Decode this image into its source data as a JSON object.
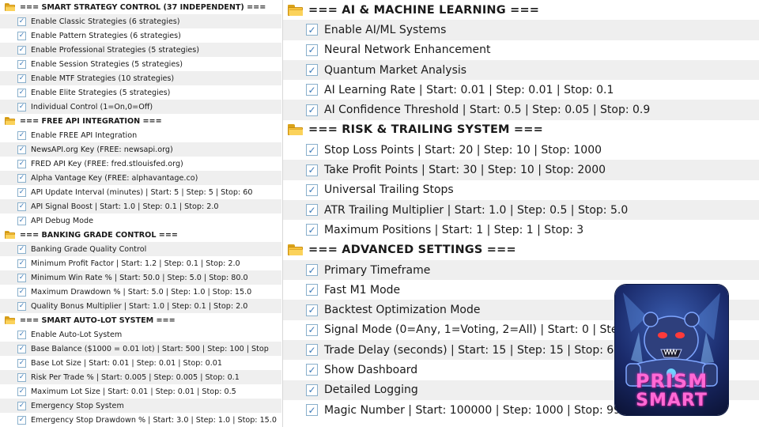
{
  "left_panel": {
    "rows": [
      {
        "type": "header",
        "label": "=== SMART STRATEGY CONTROL (37 INDEPENDENT) ==="
      },
      {
        "type": "item",
        "label": "Enable Classic Strategies (6 strategies)"
      },
      {
        "type": "item",
        "label": "Enable Pattern Strategies (6 strategies)"
      },
      {
        "type": "item",
        "label": "Enable Professional Strategies (5 strategies)"
      },
      {
        "type": "item",
        "label": "Enable Session Strategies (5 strategies)"
      },
      {
        "type": "item",
        "label": "Enable MTF Strategies (10 strategies)"
      },
      {
        "type": "item",
        "label": "Enable Elite Strategies (5 strategies)"
      },
      {
        "type": "item",
        "label": "Individual Control (1=On,0=Off)"
      },
      {
        "type": "header",
        "label": "=== FREE API INTEGRATION ==="
      },
      {
        "type": "item",
        "label": "Enable FREE API Integration"
      },
      {
        "type": "item",
        "label": "NewsAPI.org Key (FREE: newsapi.org)"
      },
      {
        "type": "item",
        "label": "FRED API Key (FREE: fred.stlouisfed.org)"
      },
      {
        "type": "item",
        "label": "Alpha Vantage Key (FREE: alphavantage.co)"
      },
      {
        "type": "item",
        "label": "API Update Interval (minutes) | Start: 5 | Step: 5 | Stop: 60"
      },
      {
        "type": "item",
        "label": "API Signal Boost | Start: 1.0 | Step: 0.1 | Stop: 2.0"
      },
      {
        "type": "item",
        "label": "API Debug Mode"
      },
      {
        "type": "header",
        "label": "=== BANKING GRADE CONTROL ==="
      },
      {
        "type": "item",
        "label": "Banking Grade Quality Control"
      },
      {
        "type": "item",
        "label": "Minimum Profit Factor | Start: 1.2 | Step: 0.1 | Stop: 2.0"
      },
      {
        "type": "item",
        "label": "Minimum Win Rate % | Start: 50.0 | Step: 5.0 | Stop: 80.0"
      },
      {
        "type": "item",
        "label": "Maximum Drawdown % | Start: 5.0 | Step: 1.0 | Stop: 15.0"
      },
      {
        "type": "item",
        "label": "Quality Bonus Multiplier | Start: 1.0 | Step: 0.1 | Stop: 2.0"
      },
      {
        "type": "header",
        "label": "=== SMART AUTO-LOT SYSTEM ==="
      },
      {
        "type": "item",
        "label": "Enable Auto-Lot System"
      },
      {
        "type": "item",
        "label": "Base Balance ($1000 = 0.01 lot) | Start: 500 | Step: 100 | Stop"
      },
      {
        "type": "item",
        "label": "Base Lot Size | Start: 0.01 | Step: 0.01 | Stop: 0.01"
      },
      {
        "type": "item",
        "label": "Risk Per Trade % | Start: 0.005 | Step: 0.005 | Stop: 0.1"
      },
      {
        "type": "item",
        "label": "Maximum Lot Size | Start: 0.01 | Step: 0.01 | Stop: 0.5"
      },
      {
        "type": "item",
        "label": "Emergency Stop System"
      },
      {
        "type": "item",
        "label": "Emergency Stop Drawdown % | Start: 3.0 | Step: 1.0 | Stop: 15.0"
      }
    ]
  },
  "right_panel": {
    "rows": [
      {
        "type": "header",
        "label": "=== AI & MACHINE LEARNING ==="
      },
      {
        "type": "item",
        "label": "Enable AI/ML Systems"
      },
      {
        "type": "item",
        "label": "Neural Network Enhancement"
      },
      {
        "type": "item",
        "label": "Quantum Market Analysis"
      },
      {
        "type": "item",
        "label": "AI Learning Rate | Start: 0.01 | Step: 0.01 | Stop: 0.1"
      },
      {
        "type": "item",
        "label": "AI Confidence Threshold | Start: 0.5 | Step: 0.05 | Stop: 0.9"
      },
      {
        "type": "header",
        "label": "=== RISK & TRAILING SYSTEM ==="
      },
      {
        "type": "item",
        "label": "Stop Loss Points | Start: 20 | Step: 10 | Stop: 1000"
      },
      {
        "type": "item",
        "label": "Take Profit Points | Start: 30 | Step: 10 | Stop: 2000"
      },
      {
        "type": "item",
        "label": "Universal Trailing Stops"
      },
      {
        "type": "item",
        "label": "ATR Trailing Multiplier | Start: 1.0 | Step: 0.5 | Stop: 5.0"
      },
      {
        "type": "item",
        "label": "Maximum Positions | Start: 1 | Step: 1 | Stop: 3"
      },
      {
        "type": "header",
        "label": "=== ADVANCED SETTINGS ==="
      },
      {
        "type": "item",
        "label": "Primary Timeframe"
      },
      {
        "type": "item",
        "label": "Fast M1 Mode"
      },
      {
        "type": "item",
        "label": "Backtest Optimization Mode"
      },
      {
        "type": "item",
        "label": "Signal Mode (0=Any, 1=Voting, 2=All) | Start: 0 | Step: 1"
      },
      {
        "type": "item",
        "label": "Trade Delay (seconds) | Start: 15 | Step: 15 | Stop: 600"
      },
      {
        "type": "item",
        "label": "Show Dashboard"
      },
      {
        "type": "item",
        "label": "Detailed Logging"
      },
      {
        "type": "item",
        "label": "Magic Number | Start: 100000 | Step: 1000 | Stop: 999999"
      }
    ]
  },
  "logo": {
    "line1": "PRISM",
    "line2": "SMART"
  },
  "icons": {
    "folder": "folder-icon",
    "checkbox": "checkbox-checked-icon",
    "check_glyph": "✓"
  },
  "colors": {
    "row_alt": "#efefef",
    "row_white": "#ffffff",
    "folder": "#f7c23a",
    "check": "#3d7ab8",
    "logo_text": "#ff6ad5"
  }
}
